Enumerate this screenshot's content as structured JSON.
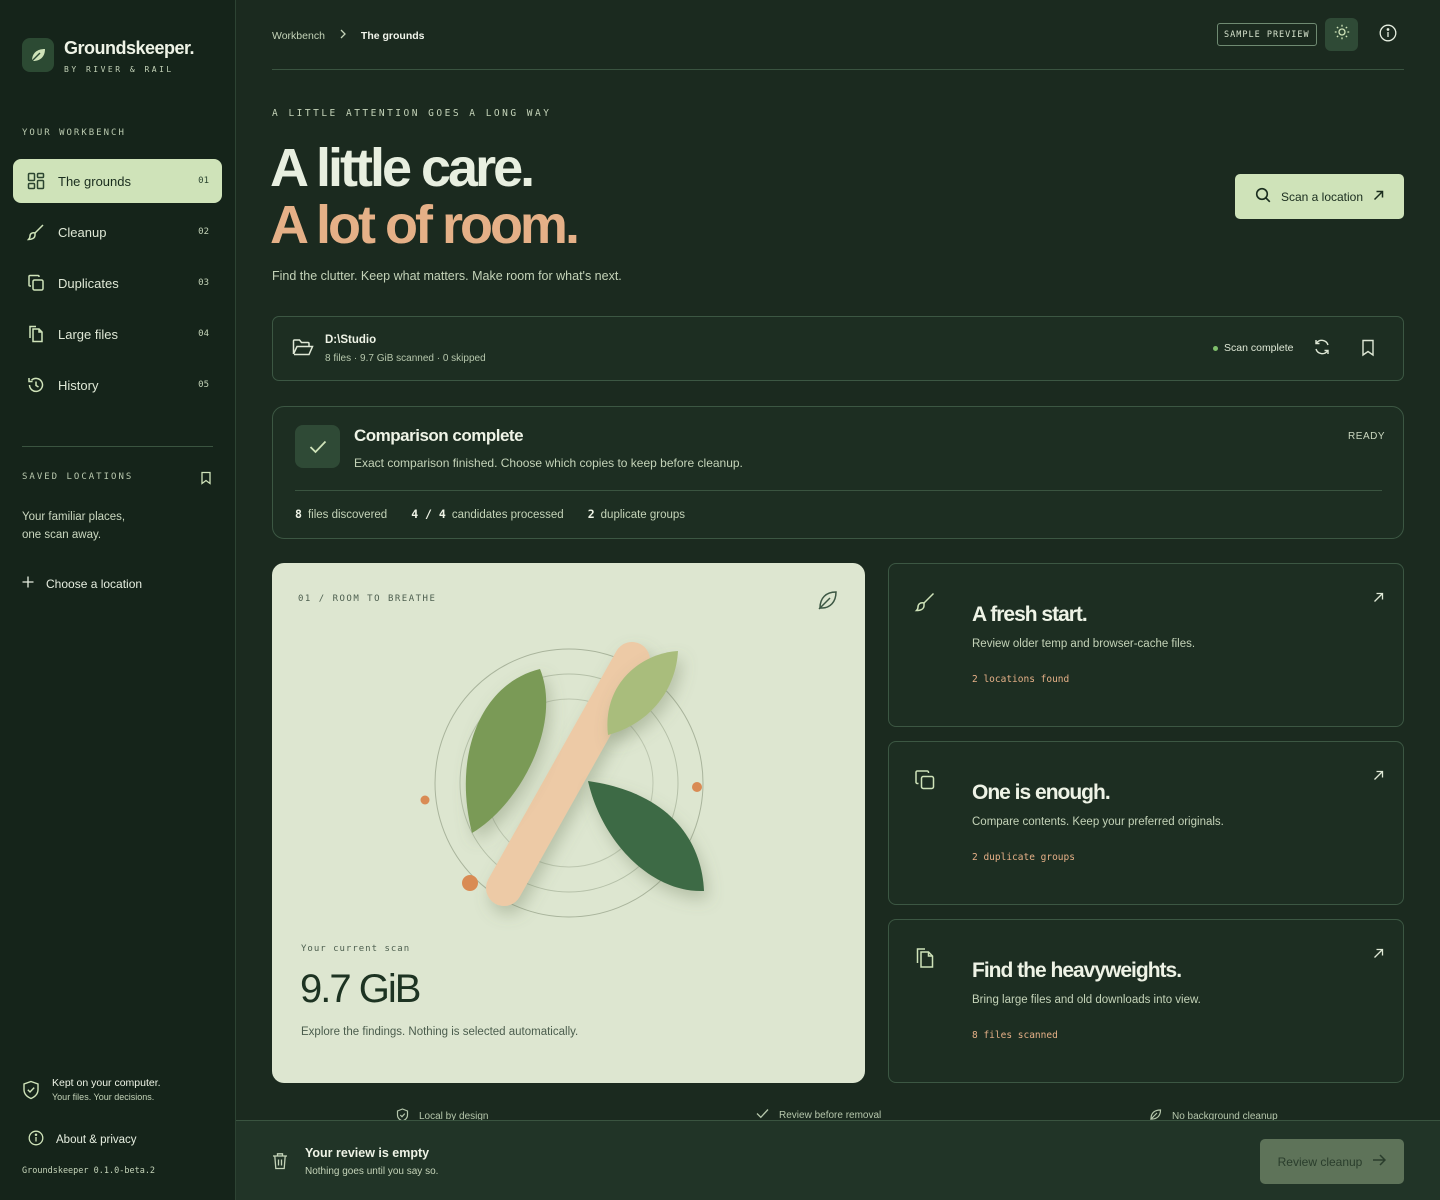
{
  "brand": {
    "name": "Groundskeeper.",
    "subtitle": "BY RIVER & RAIL"
  },
  "sidebar": {
    "section_label": "YOUR WORKBENCH",
    "items": [
      {
        "label": "The grounds",
        "num": "01",
        "icon": "grid-icon",
        "active": true
      },
      {
        "label": "Cleanup",
        "num": "02",
        "icon": "brush-icon"
      },
      {
        "label": "Duplicates",
        "num": "03",
        "icon": "copy-icon"
      },
      {
        "label": "Large files",
        "num": "04",
        "icon": "files-icon"
      },
      {
        "label": "History",
        "num": "05",
        "icon": "history-icon"
      }
    ],
    "saved_label": "SAVED LOCATIONS",
    "saved_desc_line1": "Your familiar places,",
    "saved_desc_line2": "one scan away.",
    "choose_location": "Choose a location",
    "privacy_title": "Kept on your computer.",
    "privacy_sub": "Your files. Your decisions.",
    "about": "About & privacy",
    "version": "Groundskeeper 0.1.0-beta.2"
  },
  "topbar": {
    "breadcrumb_root": "Workbench",
    "breadcrumb_current": "The grounds",
    "sample_badge": "SAMPLE PREVIEW"
  },
  "hero": {
    "eyebrow": "A LITTLE ATTENTION GOES A LONG WAY",
    "line1": "A little care.",
    "line2": "A lot of room.",
    "subtitle": "Find the clutter. Keep what matters. Make room for what's next.",
    "scan_button": "Scan a location"
  },
  "location": {
    "path": "D:\\Studio",
    "meta": "8 files · 9.7 GiB scanned · 0 skipped",
    "status": "Scan complete"
  },
  "comparison": {
    "title": "Comparison complete",
    "desc": "Exact comparison finished. Choose which copies to keep before cleanup.",
    "ready": "READY",
    "stat1_num": "8",
    "stat1_label": "files discovered",
    "stat2_num": "4 / 4",
    "stat2_label": "candidates processed",
    "stat3_num": "2",
    "stat3_label": "duplicate groups"
  },
  "room": {
    "label": "01 / ROOM TO BREATHE",
    "caption": "Your current scan",
    "value": "9.7 GiB",
    "desc": "Explore the findings. Nothing is selected automatically."
  },
  "cards": [
    {
      "title": "A fresh start.",
      "desc": "Review older temp and browser-cache files.",
      "note": "2 locations found",
      "icon": "brush-icon"
    },
    {
      "title": "One is enough.",
      "desc": "Compare contents. Keep your preferred originals.",
      "note": "2 duplicate groups",
      "icon": "copy-icon"
    },
    {
      "title": "Find the heavyweights.",
      "desc": "Bring large files and old downloads into view.",
      "note": "8 files scanned",
      "icon": "files-icon"
    }
  ],
  "assurances": [
    "Local by design",
    "Review before removal",
    "No background cleanup"
  ],
  "review": {
    "title": "Your review is empty",
    "sub": "Nothing goes until you say so.",
    "button": "Review cleanup"
  },
  "colors": {
    "background": "#1b2a1f",
    "sidebar": "#15241a",
    "accent_green": "#cfe3b9",
    "accent_peach": "#e5b087",
    "card_light": "#dde6d0"
  }
}
